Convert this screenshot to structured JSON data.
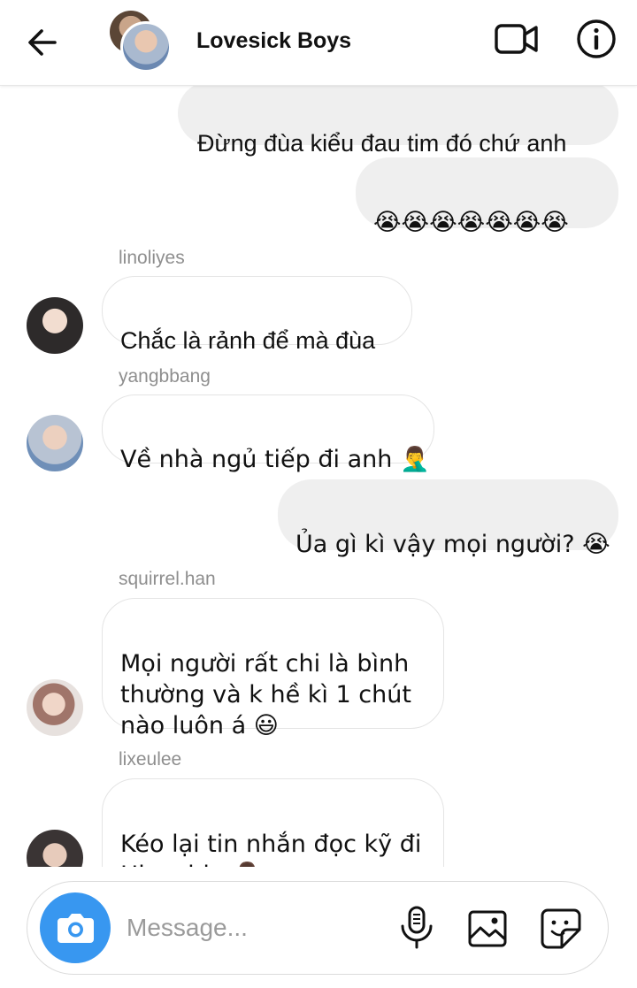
{
  "header": {
    "title": "Lovesick Boys"
  },
  "messages": [
    {
      "type": "outgoing",
      "text": "Đừng đùa kiểu đau tim đó chứ anh"
    },
    {
      "type": "outgoing",
      "text": "😭😭😭😭😭😭😭"
    },
    {
      "type": "incoming",
      "sender": "linoliyes",
      "text": "Chắc là rảnh để mà đùa"
    },
    {
      "type": "incoming",
      "sender": "yangbbang",
      "text": "Về nhà ngủ tiếp đi anh 🤦‍♂️"
    },
    {
      "type": "outgoing",
      "text": "Ủa gì kì vậy mọi người? 😭"
    },
    {
      "type": "incoming",
      "sender": "squirrel.han",
      "text": "Mọi người rất chi là bình\nthường và k hề kì 1 chút\nnào luôn á 😃"
    },
    {
      "type": "incoming",
      "sender": "lixeulee",
      "text": "Kéo lại tin nhắn đọc kỹ đi\nHionchin 🤦‍♂️"
    }
  ],
  "composer": {
    "placeholder": "Message..."
  },
  "colors": {
    "accent": "#3897f0",
    "outgoing_bubble": "#efefef",
    "sender_name": "#8e8e8e"
  },
  "icons": [
    "back-arrow-icon",
    "video-call-icon",
    "info-icon",
    "camera-icon",
    "microphone-icon",
    "gallery-icon",
    "sticker-icon"
  ]
}
